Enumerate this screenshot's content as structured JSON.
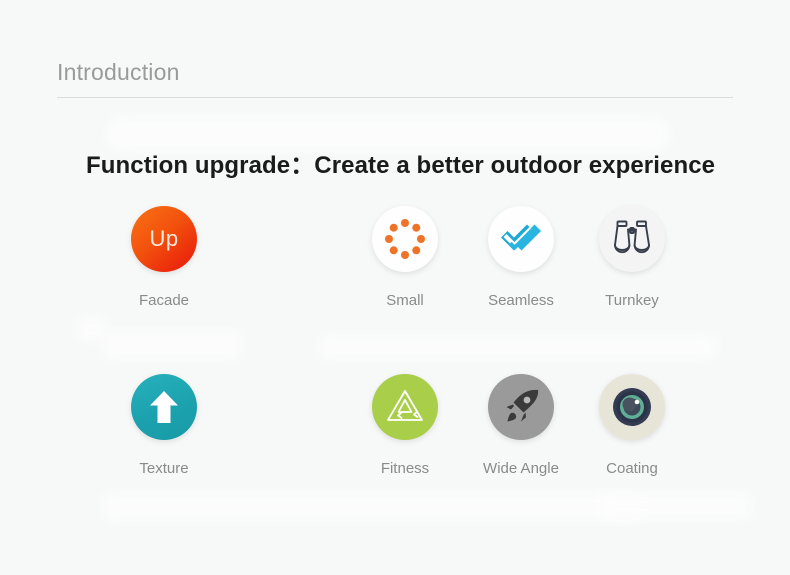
{
  "section": {
    "title": "Introduction"
  },
  "headline": {
    "prefix": "Function upgrade",
    "separator": "：",
    "text": "Create a better outdoor experience"
  },
  "colors": {
    "page_background": "#f7f8f8",
    "section_title": "#9a9a9a",
    "divider": "#dcdcdc",
    "headline": "#1b1b1b",
    "caption": "#8a8a8a",
    "facade_gradient_start": "#f97316",
    "facade_gradient_end": "#e8150b",
    "small_dots": "#ef7326",
    "seamless_check": "#29b5e0",
    "turnkey_outline": "#393f4c",
    "texture_circle": "#1ba2ae",
    "fitness_circle": "#a8ce4a",
    "wide_angle_circle": "#9a9a9a",
    "coating_ring": "#e7e5d8",
    "coating_body": "#343c52",
    "coating_lens": "#5fae95"
  },
  "features": {
    "rows": [
      {
        "items": [
          {
            "label": "Facade",
            "icon": "up-badge-icon",
            "badge_text": "Up"
          },
          {
            "label": "Small",
            "icon": "dot-ring-icon",
            "badge_text": ""
          },
          {
            "label": "Seamless",
            "icon": "double-check-icon",
            "badge_text": ""
          },
          {
            "label": "Turnkey",
            "icon": "binoculars-icon",
            "badge_text": ""
          }
        ]
      },
      {
        "items": [
          {
            "label": "Texture",
            "icon": "arrow-up-icon",
            "badge_text": ""
          },
          {
            "label": "Fitness",
            "icon": "recycle-icon",
            "badge_text": ""
          },
          {
            "label": "Wide Angle",
            "icon": "rocket-icon",
            "badge_text": ""
          },
          {
            "label": "Coating",
            "icon": "camera-lens-icon",
            "badge_text": ""
          }
        ]
      }
    ]
  }
}
